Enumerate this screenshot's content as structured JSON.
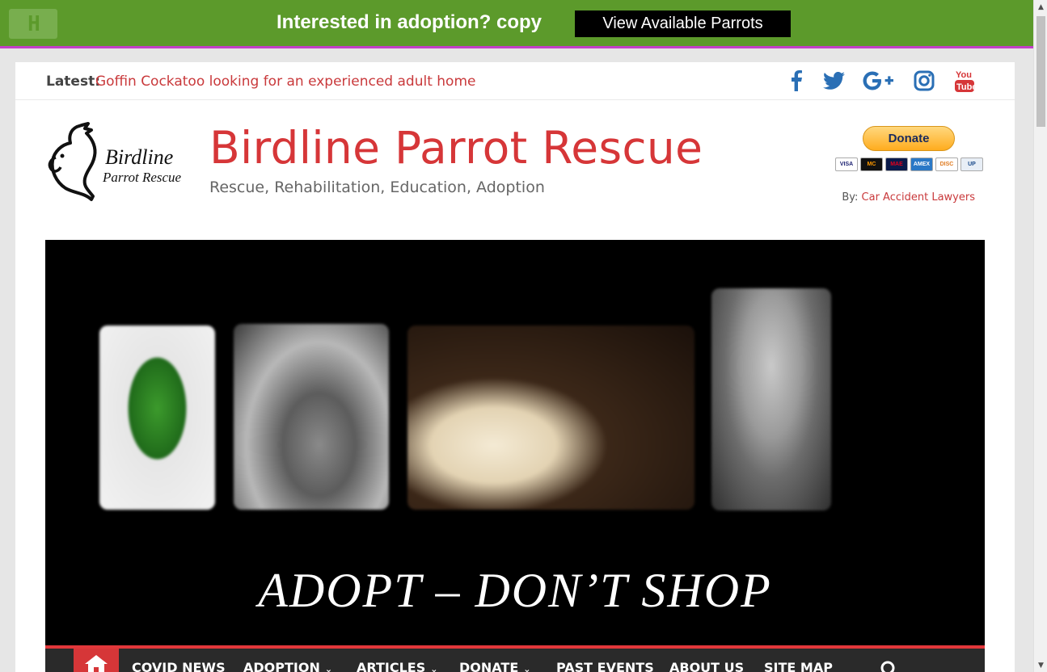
{
  "promo": {
    "logo_glyph": "H",
    "headline": "Interested in adoption? copy",
    "cta_label": "View Available Parrots"
  },
  "topbar": {
    "latest_label": "Latest:",
    "latest_link": "Goffin Cockatoo looking for an experienced adult home",
    "social_icons": [
      "facebook-icon",
      "twitter-icon",
      "google-plus-icon",
      "instagram-icon",
      "youtube-icon"
    ]
  },
  "header": {
    "logo_line1": "Birdline",
    "logo_line2": "Parrot Rescue",
    "site_title": "Birdline Parrot Rescue",
    "tagline": "Rescue, Rehabilitation, Education, Adoption",
    "donate_label": "Donate",
    "payment_cards": [
      "VISA",
      "MC",
      "MAE",
      "AMEX",
      "DISC",
      "UP"
    ],
    "by_label": "By:",
    "by_link": "Car Accident Lawyers"
  },
  "hero": {
    "caption": "ADOPT – DON’T  SHOP"
  },
  "nav": {
    "items": [
      {
        "label": "COVID NEWS",
        "has_dropdown": false
      },
      {
        "label": "ADOPTION",
        "has_dropdown": true
      },
      {
        "label": "ARTICLES",
        "has_dropdown": true
      },
      {
        "label": "DONATE",
        "has_dropdown": true
      },
      {
        "label": "PAST EVENTS",
        "has_dropdown": false
      },
      {
        "label": "ABOUT US",
        "has_dropdown": false
      },
      {
        "label": "SITE MAP",
        "has_dropdown": false
      }
    ],
    "chevron": "⌄"
  },
  "colors": {
    "promo_green": "#5c9a2b",
    "accent_red": "#d63638",
    "social_blue": "#2a6fb5",
    "youtube_red": "#d63638",
    "nav_bg": "#2a2a2a"
  }
}
